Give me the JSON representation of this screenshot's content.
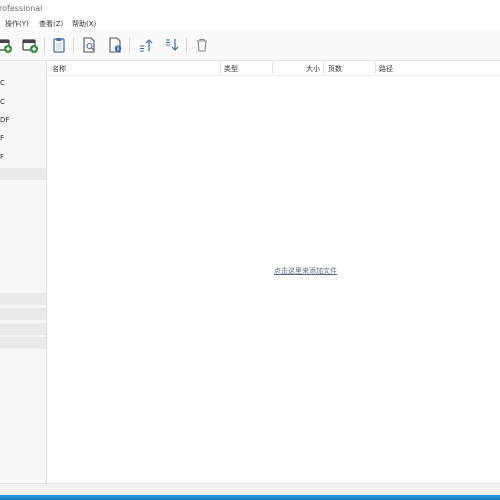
{
  "window": {
    "title": "rofessional"
  },
  "menu": {
    "items": [
      "操作(Y)",
      "查看(Z)",
      "帮助(X)"
    ]
  },
  "toolbar": {
    "buttons": [
      {
        "name": "add-files-button",
        "icon": "folder-add-icon"
      },
      {
        "name": "add-folder-button",
        "icon": "folder-add-icon"
      },
      {
        "name": "paste-button",
        "icon": "clipboard-icon"
      },
      {
        "name": "preview-button",
        "icon": "document-search-icon"
      },
      {
        "name": "info-button",
        "icon": "document-info-icon"
      },
      {
        "name": "move-up-button",
        "icon": "arrow-up-icon"
      },
      {
        "name": "move-down-button",
        "icon": "arrow-down-icon"
      },
      {
        "name": "delete-button",
        "icon": "trash-icon"
      }
    ],
    "accent_color": "#2e8b3a"
  },
  "sidebar": {
    "items": [
      "C",
      "C",
      "DF",
      "F",
      "F"
    ]
  },
  "table": {
    "columns": [
      "名称",
      "类型",
      "大小",
      "页数",
      "路径"
    ]
  },
  "main": {
    "add_hint": "点击这里来添加文件"
  }
}
